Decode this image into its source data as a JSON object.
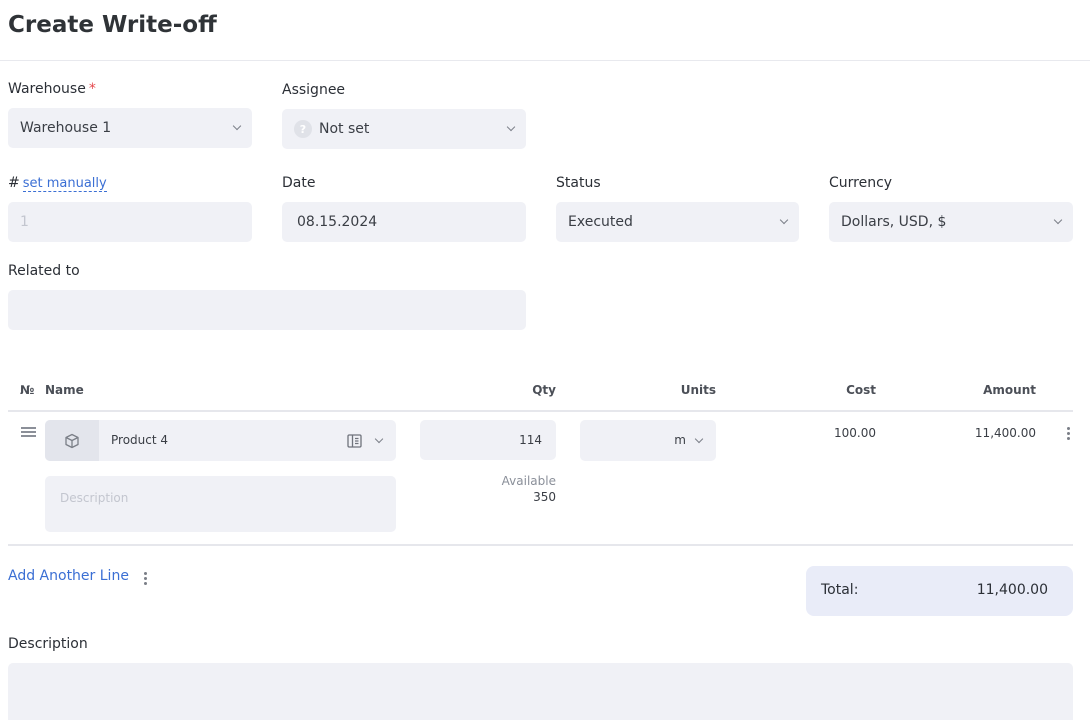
{
  "page": {
    "title": "Create Write-off"
  },
  "form": {
    "warehouse": {
      "label": "Warehouse",
      "required_mark": "*",
      "value": "Warehouse 1"
    },
    "assignee": {
      "label": "Assignee",
      "avatar_glyph": "?",
      "value": "Not set"
    },
    "number": {
      "label": "#",
      "link": "set manually",
      "value": "1"
    },
    "date": {
      "label": "Date",
      "value": "08.15.2024"
    },
    "status": {
      "label": "Status",
      "value": "Executed"
    },
    "currency": {
      "label": "Currency",
      "value": "Dollars, USD, $"
    },
    "related": {
      "label": "Related to",
      "value": ""
    }
  },
  "table": {
    "headers": {
      "no": "№",
      "name": "Name",
      "qty": "Qty",
      "units": "Units",
      "cost": "Cost",
      "amount": "Amount"
    },
    "rows": [
      {
        "product": "Product 4",
        "qty": "114",
        "units": "m",
        "cost": "100.00",
        "amount": "11,400.00",
        "available_label": "Available",
        "available": "350",
        "description_placeholder": "Description"
      }
    ]
  },
  "add_line": {
    "label": "Add Another Line"
  },
  "total": {
    "label": "Total:",
    "value": "11,400.00"
  },
  "description": {
    "label": "Description",
    "value": ""
  },
  "icons": {
    "product": "cube-icon",
    "catalog": "catalog-icon",
    "drag": "drag-handle-icon",
    "more": "kebab-icon",
    "dropdown": "chevron-down-icon"
  }
}
